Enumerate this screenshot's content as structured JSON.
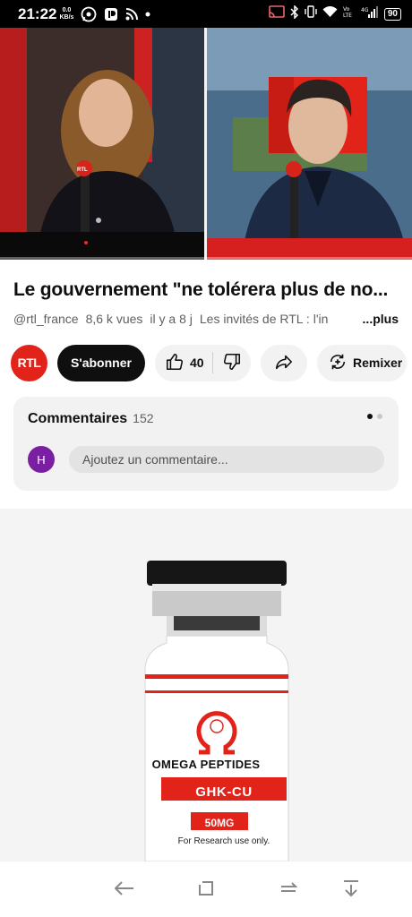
{
  "status_bar": {
    "time": "21:22",
    "speed_value": "0.0",
    "speed_unit": "KB/s",
    "battery": "90"
  },
  "video": {
    "progress_fraction": 0.0,
    "logo_text": "RTL"
  },
  "title": "Le gouvernement \"ne tolérera plus de no...",
  "meta": {
    "channel": "@rtl_france",
    "views": "8,6 k vues",
    "age": "il y a 8 j",
    "description_snippet": "Les invités de RTL : l'in",
    "more": "...plus"
  },
  "actions": {
    "channel_avatar": "RTL",
    "subscribe_label": "S'abonner",
    "like_count": "40",
    "remix_label": "Remixer"
  },
  "comments": {
    "heading": "Commentaires",
    "count": "152",
    "user_initial": "H",
    "placeholder": "Ajoutez un commentaire..."
  },
  "ad": {
    "brand": "OMEGA PEPTIDES",
    "product": "GHK-CU",
    "dosage": "50MG",
    "note": "For Research use only."
  },
  "colors": {
    "accent_red": "#e2231a",
    "youtube_red": "#ff0000",
    "comment_avatar": "#7b1fa2"
  }
}
